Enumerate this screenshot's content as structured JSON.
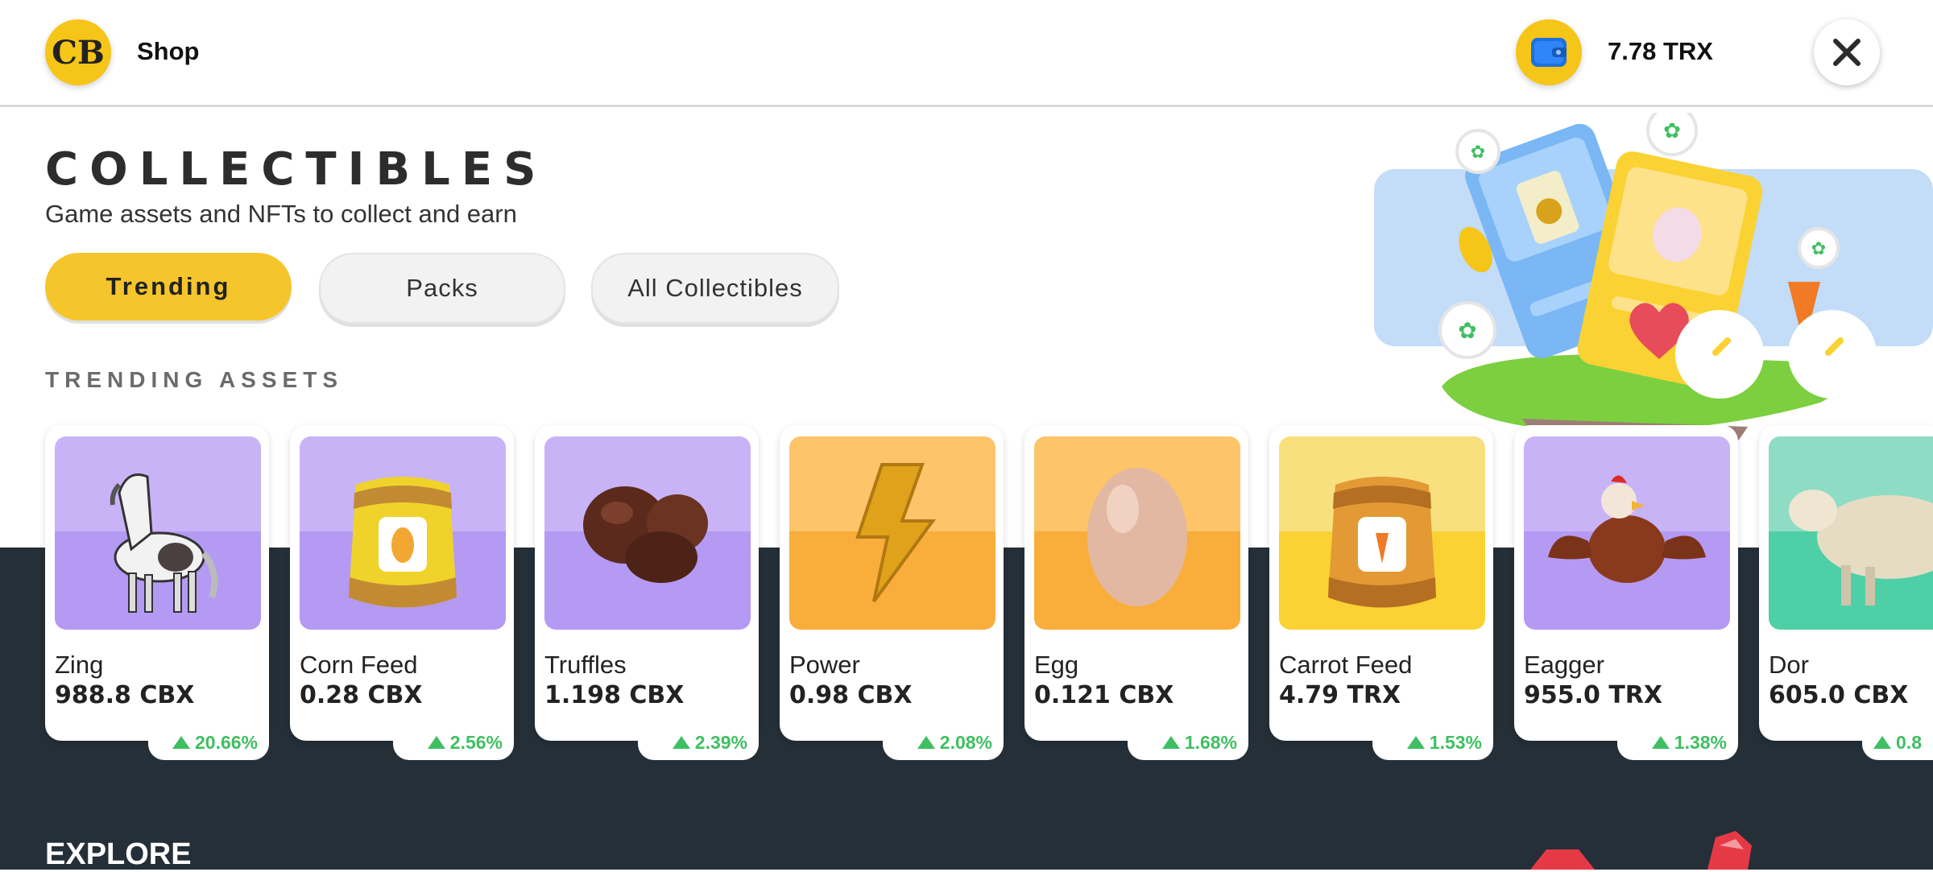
{
  "header": {
    "logo_text": "CB",
    "title": "Shop",
    "balance": "7.78 TRX",
    "close_icon": "close-icon",
    "wallet_icon": "wallet-icon"
  },
  "page": {
    "heading": "COLLECTIBLES",
    "subtitle": "Game assets and NFTs to collect and earn"
  },
  "tabs": [
    {
      "label": "Trending",
      "active": true
    },
    {
      "label": "Packs",
      "active": false
    },
    {
      "label": "All Collectibles",
      "active": false
    }
  ],
  "section_title": "TRENDING ASSETS",
  "assets": [
    {
      "name": "Zing",
      "price": "988.8 CBX",
      "change": "20.66%",
      "image": "horse",
      "color_top": "#c9b3f7",
      "color_bottom": "#b49af3"
    },
    {
      "name": "Corn Feed",
      "price": "0.28 CBX",
      "change": "2.56%",
      "image": "corn-feed-bag",
      "color_top": "#c9b3f7",
      "color_bottom": "#b49af3"
    },
    {
      "name": "Truffles",
      "price": "1.198 CBX",
      "change": "2.39%",
      "image": "truffles",
      "color_top": "#c9b3f7",
      "color_bottom": "#b49af3"
    },
    {
      "name": "Power",
      "price": "0.98 CBX",
      "change": "2.08%",
      "image": "lightning-bolt",
      "color_top": "#fdc46a",
      "color_bottom": "#f9ad3b"
    },
    {
      "name": "Egg",
      "price": "0.121 CBX",
      "change": "1.68%",
      "image": "egg",
      "color_top": "#fdc46a",
      "color_bottom": "#f9ad3b"
    },
    {
      "name": "Carrot Feed",
      "price": "4.79 TRX",
      "change": "1.53%",
      "image": "carrot-feed-bag",
      "color_top": "#f8e07f",
      "color_bottom": "#fbd233"
    },
    {
      "name": "Eagger",
      "price": "955.0 TRX",
      "change": "1.38%",
      "image": "chicken",
      "color_top": "#c9b3f7",
      "color_bottom": "#b49af3"
    },
    {
      "name": "Dor",
      "price": "605.0 CBX",
      "change": "0.8",
      "image": "sheep",
      "color_top": "#8fdcc4",
      "color_bottom": "#4fcfa6"
    }
  ],
  "explore_title": "EXPLORE",
  "colors": {
    "accent": "#f5c52c",
    "dark_band": "#242f38",
    "positive": "#3fbf62"
  }
}
